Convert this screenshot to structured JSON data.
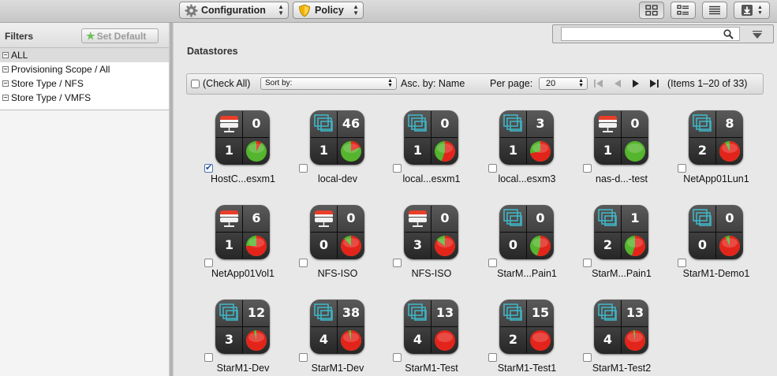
{
  "toolbar": {
    "configuration_label": "Configuration",
    "policy_label": "Policy"
  },
  "sidebar": {
    "title": "Filters",
    "set_default_label": "Set Default",
    "items": [
      {
        "label": "ALL",
        "selected": true
      },
      {
        "label": "Provisioning Scope / All",
        "selected": false
      },
      {
        "label": "Store Type / NFS",
        "selected": false
      },
      {
        "label": "Store Type / VMFS",
        "selected": false
      }
    ]
  },
  "search": {
    "value": "",
    "placeholder": ""
  },
  "main": {
    "title": "Datastores",
    "check_all_label": "(Check All)",
    "sort_by_label": "Sort by:",
    "asc_label": "Asc. by: Name",
    "per_page_label": "Per page:",
    "per_page_value": "20",
    "items_label": "(Items 1–20 of 33)"
  },
  "colors": {
    "pie_red": "#e3241b",
    "pie_green": "#55b52e",
    "tile_bg": "#3a3a3a",
    "vm_icon": "#3fb4c4",
    "nfs_icon": "#e83e2a"
  },
  "datastores": [
    {
      "name": "HostC...esxm1",
      "type": "nfs",
      "top": "0",
      "bottom": "1",
      "used": 0.08,
      "checked": true
    },
    {
      "name": "local-dev",
      "type": "vm",
      "top": "46",
      "bottom": "1",
      "used": 0.18,
      "checked": false
    },
    {
      "name": "local...esxm1",
      "type": "vm",
      "top": "0",
      "bottom": "1",
      "used": 0.55,
      "checked": false
    },
    {
      "name": "local...esxm3",
      "type": "vm",
      "top": "3",
      "bottom": "1",
      "used": 0.72,
      "checked": false
    },
    {
      "name": "nas-d...-test",
      "type": "nfs",
      "top": "0",
      "bottom": "1",
      "used": 0.0,
      "checked": false
    },
    {
      "name": "NetApp01Lun1",
      "type": "vm",
      "top": "8",
      "bottom": "2",
      "used": 0.92,
      "checked": false
    },
    {
      "name": "NetApp01Vol1",
      "type": "nfs",
      "top": "6",
      "bottom": "1",
      "used": 0.75,
      "checked": false
    },
    {
      "name": "NFS-ISO",
      "type": "nfs",
      "top": "0",
      "bottom": "0",
      "used": 0.88,
      "checked": false
    },
    {
      "name": "NFS-ISO",
      "type": "nfs",
      "top": "0",
      "bottom": "3",
      "used": 0.85,
      "checked": false
    },
    {
      "name": "StarM...Pain1",
      "type": "vm",
      "top": "0",
      "bottom": "0",
      "used": 0.55,
      "checked": false
    },
    {
      "name": "StarM...Pain1",
      "type": "vm",
      "top": "1",
      "bottom": "2",
      "used": 0.55,
      "checked": false
    },
    {
      "name": "StarM1-Demo1",
      "type": "vm",
      "top": "0",
      "bottom": "0",
      "used": 0.93,
      "checked": false
    },
    {
      "name": "StarM1-Dev",
      "type": "vm",
      "top": "12",
      "bottom": "3",
      "used": 0.96,
      "checked": false
    },
    {
      "name": "StarM1-Dev",
      "type": "vm",
      "top": "38",
      "bottom": "4",
      "used": 0.96,
      "checked": false
    },
    {
      "name": "StarM1-Test",
      "type": "vm",
      "top": "13",
      "bottom": "4",
      "used": 1.0,
      "checked": false
    },
    {
      "name": "StarM1-Test1",
      "type": "vm",
      "top": "15",
      "bottom": "2",
      "used": 1.0,
      "checked": false
    },
    {
      "name": "StarM1-Test2",
      "type": "vm",
      "top": "13",
      "bottom": "4",
      "used": 0.97,
      "checked": false
    }
  ]
}
